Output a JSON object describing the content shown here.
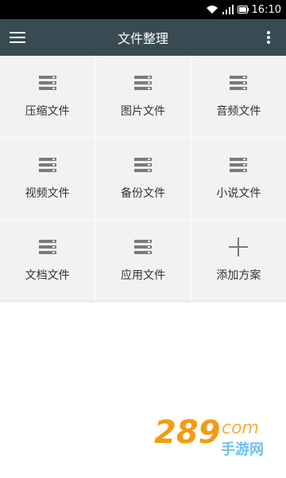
{
  "status_bar": {
    "time": "16:10"
  },
  "app_bar": {
    "title": "文件整理"
  },
  "grid": {
    "items": [
      {
        "label": "压缩文件",
        "icon": "list-icon"
      },
      {
        "label": "图片文件",
        "icon": "list-icon"
      },
      {
        "label": "音频文件",
        "icon": "list-icon"
      },
      {
        "label": "视频文件",
        "icon": "list-icon"
      },
      {
        "label": "备份文件",
        "icon": "list-icon"
      },
      {
        "label": "小说文件",
        "icon": "list-icon"
      },
      {
        "label": "文档文件",
        "icon": "list-icon"
      },
      {
        "label": "应用文件",
        "icon": "list-icon"
      },
      {
        "label": "添加方案",
        "icon": "plus-icon"
      }
    ]
  },
  "watermark": {
    "brand": "289",
    "domain": ".com",
    "subtitle": "手游网"
  },
  "colors": {
    "app_bar": "#384b52",
    "tile_background": "#f2f2f2",
    "icon": "#7a7a7a",
    "watermark_orange": "#f39c12"
  }
}
